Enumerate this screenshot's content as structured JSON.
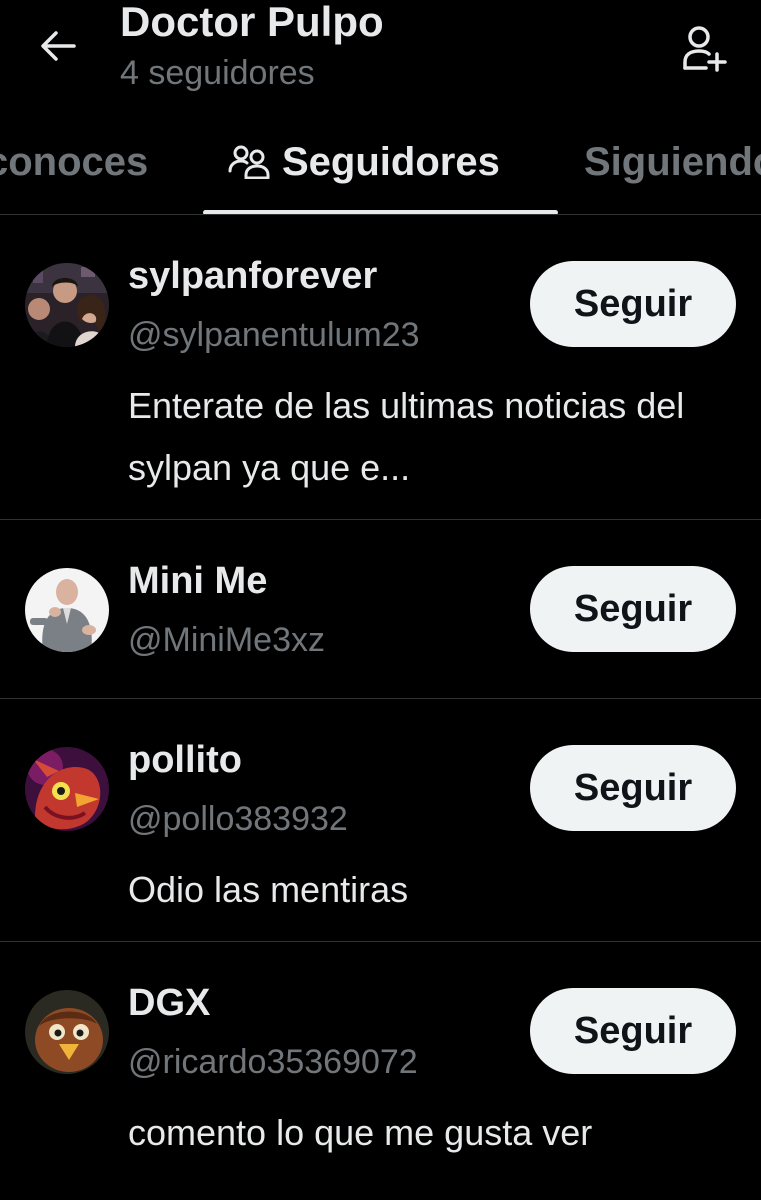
{
  "header": {
    "title": "Doctor Pulpo",
    "subtitle": "4 seguidores",
    "back_icon": "arrow-left-icon",
    "add_icon": "person-add-icon"
  },
  "tabs": [
    {
      "label": "conoces",
      "active": false
    },
    {
      "label": "Seguidores",
      "active": true,
      "icon": "people-icon"
    },
    {
      "label": "Siguiendo",
      "active": false
    }
  ],
  "users": [
    {
      "name": "sylpanforever",
      "handle": "@sylpanentulum23",
      "bio": "Enterate de las ultimas noticias del sylpan ya que e...",
      "button": "Seguir"
    },
    {
      "name": "Mini Me",
      "handle": "@MiniMe3xz",
      "bio": "",
      "button": "Seguir"
    },
    {
      "name": "pollito",
      "handle": "@pollo383932",
      "bio": "Odio las mentiras",
      "button": "Seguir"
    },
    {
      "name": "DGX",
      "handle": "@ricardo35369072",
      "bio": "comento lo que me gusta ver",
      "button": "Seguir"
    }
  ],
  "colors": {
    "background": "#000000",
    "text": "#e7e9ea",
    "secondary": "#71767b",
    "button_bg": "#eff3f4",
    "divider": "#2f3336"
  }
}
